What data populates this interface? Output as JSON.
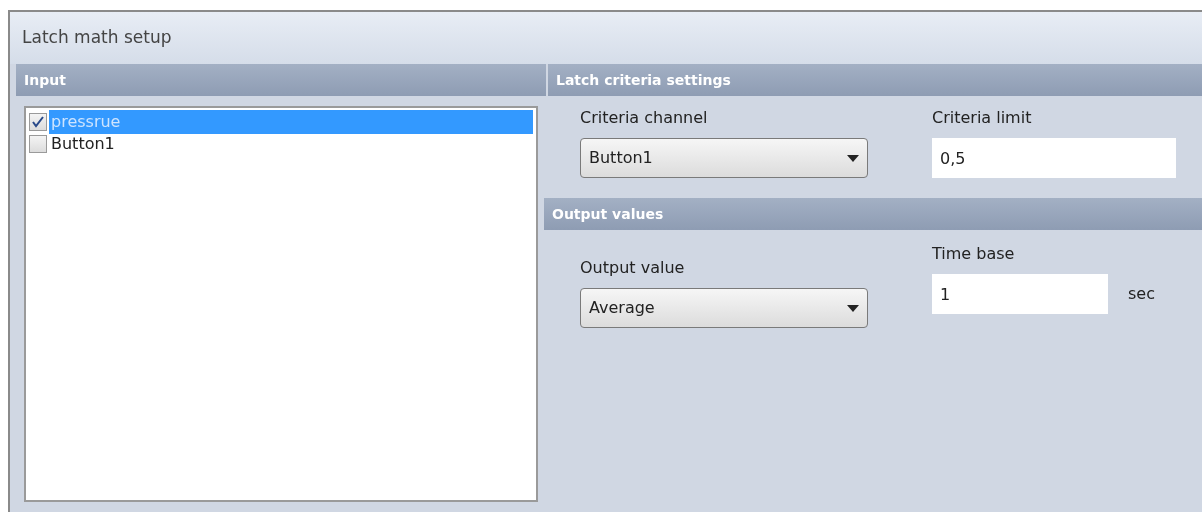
{
  "window": {
    "title": "Latch math setup"
  },
  "input": {
    "header": "Input",
    "items": [
      {
        "label": "pressrue",
        "checked": true,
        "selected": true
      },
      {
        "label": "Button1",
        "checked": false,
        "selected": false
      }
    ]
  },
  "criteria": {
    "header": "Latch criteria settings",
    "channel_label": "Criteria channel",
    "channel_value": "Button1",
    "limit_label": "Criteria limit",
    "limit_value": "0,5"
  },
  "output": {
    "header": "Output values",
    "value_label": "Output value",
    "value": "Average",
    "time_base_label": "Time base",
    "time_base_value": "1",
    "unit": "sec"
  }
}
